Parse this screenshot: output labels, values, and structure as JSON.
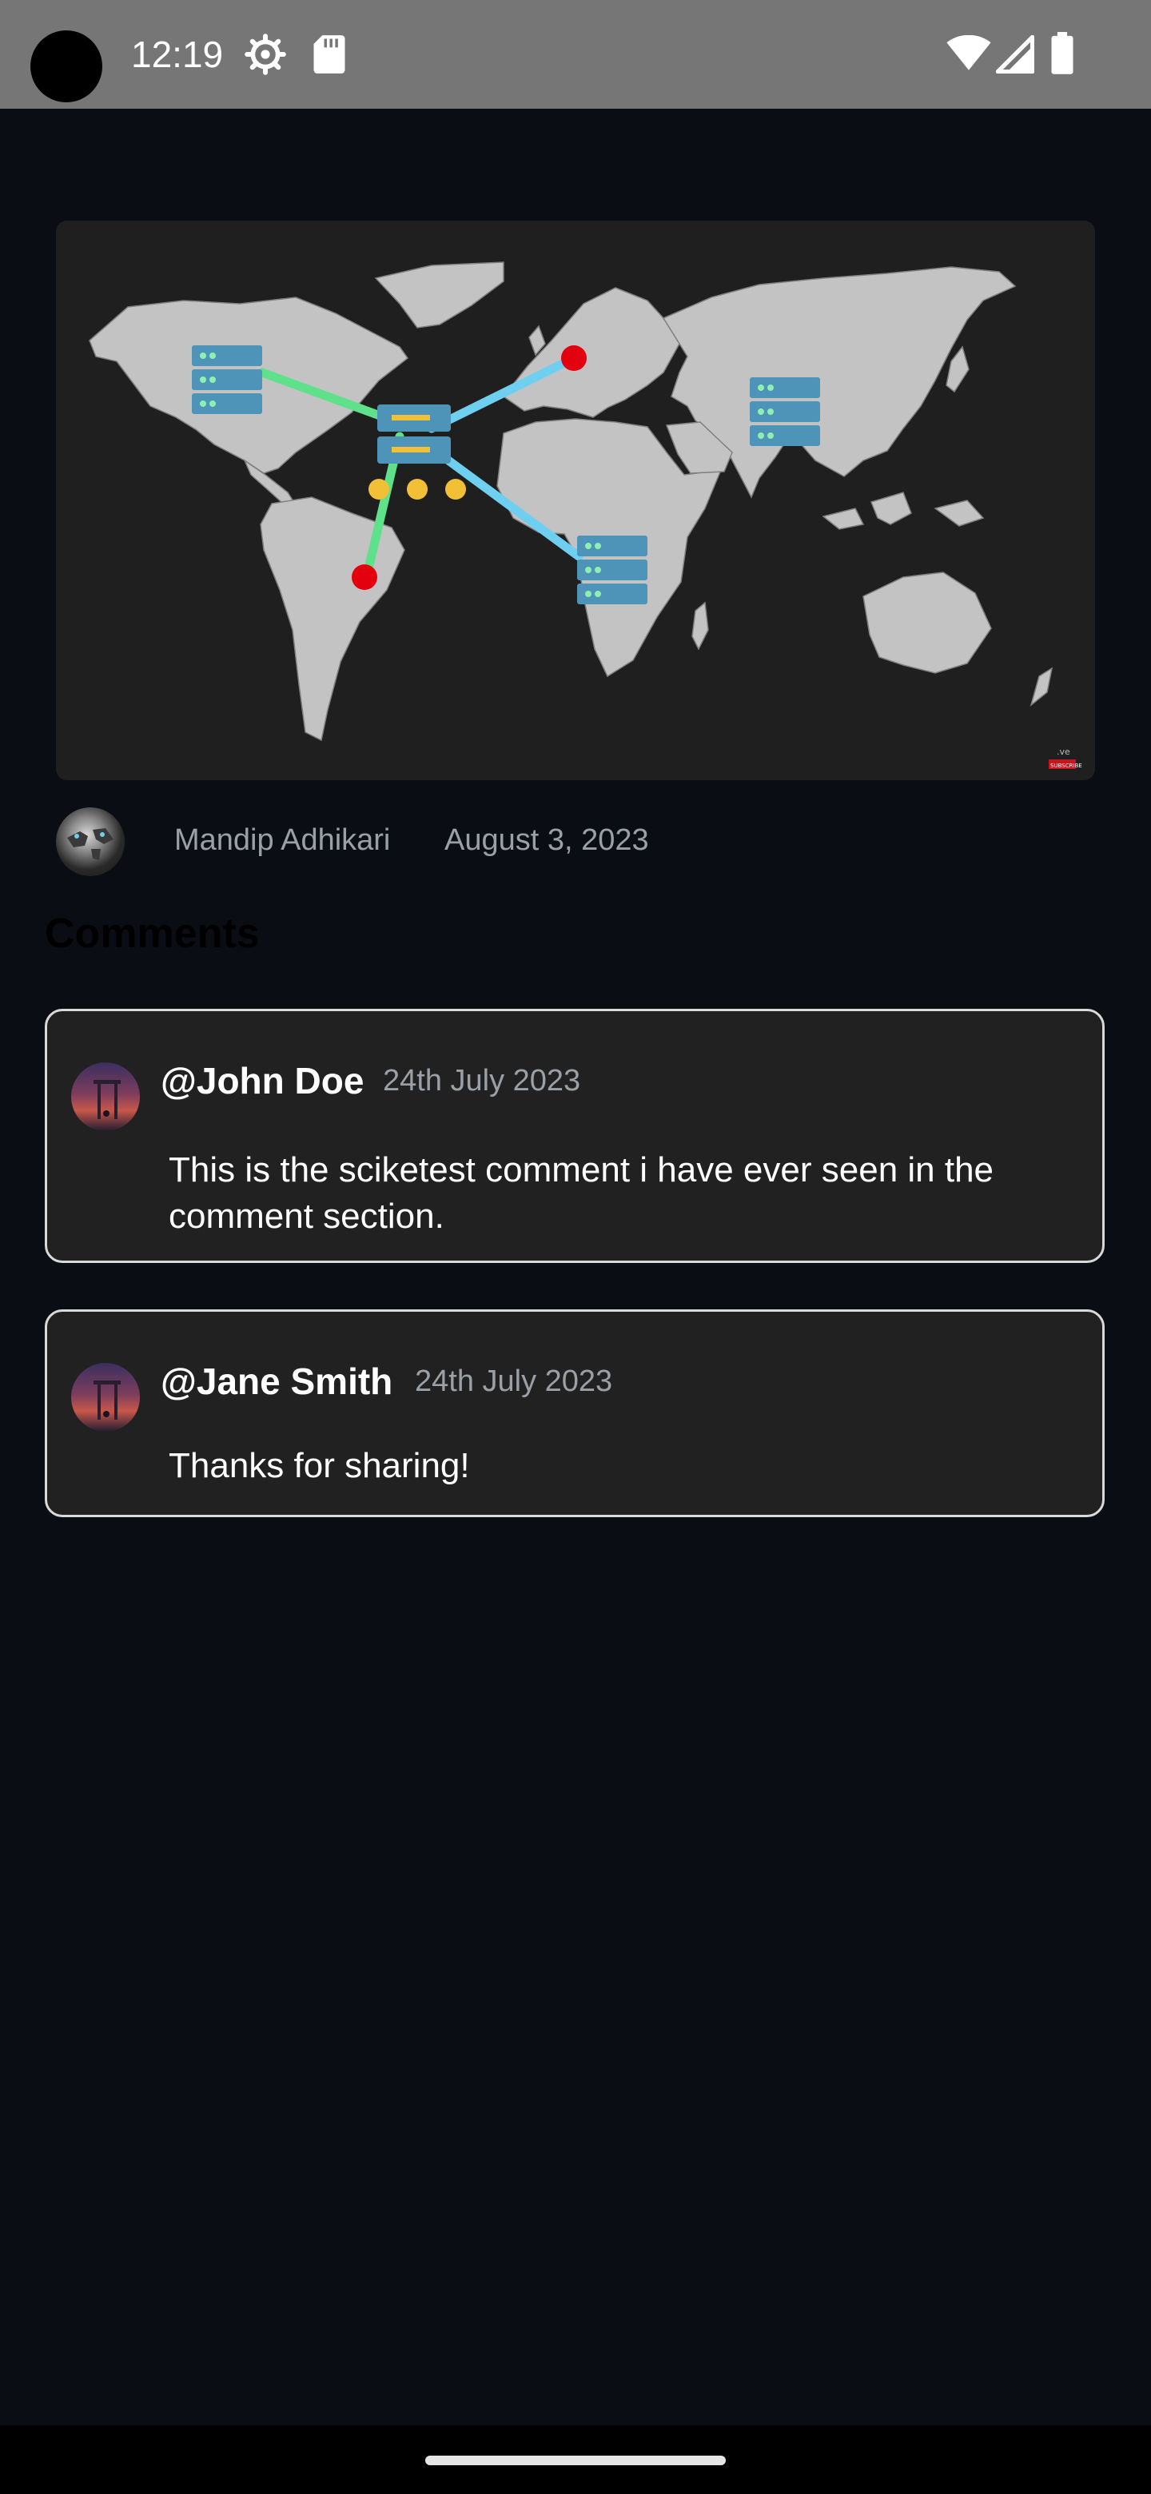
{
  "status_bar": {
    "time": "12:19",
    "left_icons": [
      "settings-gear-icon",
      "sd-card-icon"
    ],
    "right_icons": [
      "wifi-icon",
      "signal-icon",
      "battery-icon"
    ]
  },
  "post": {
    "image_badge_text": "SUBSCRIBE",
    "author": "Mandip Adhikari",
    "date": "August 3, 2023"
  },
  "comments_section": {
    "heading": "Comments",
    "heading_color": "#000000",
    "comments": [
      {
        "user": "@John Doe",
        "date": "24th July 2023",
        "text": "This is the sciketest comment i have ever seen in the comment section."
      },
      {
        "user": "@Jane Smith",
        "date": "24th July 2023",
        "text": "Thanks for sharing!"
      }
    ]
  },
  "colors": {
    "background": "#0b0d14",
    "card": "#212121",
    "card_border": "#d9d9d9",
    "muted_text": "#9aa0a6",
    "green_link": "#5fe08a",
    "blue_link": "#6fcff0",
    "red_marker": "#e3000f",
    "yellow_dot": "#f2c037"
  }
}
